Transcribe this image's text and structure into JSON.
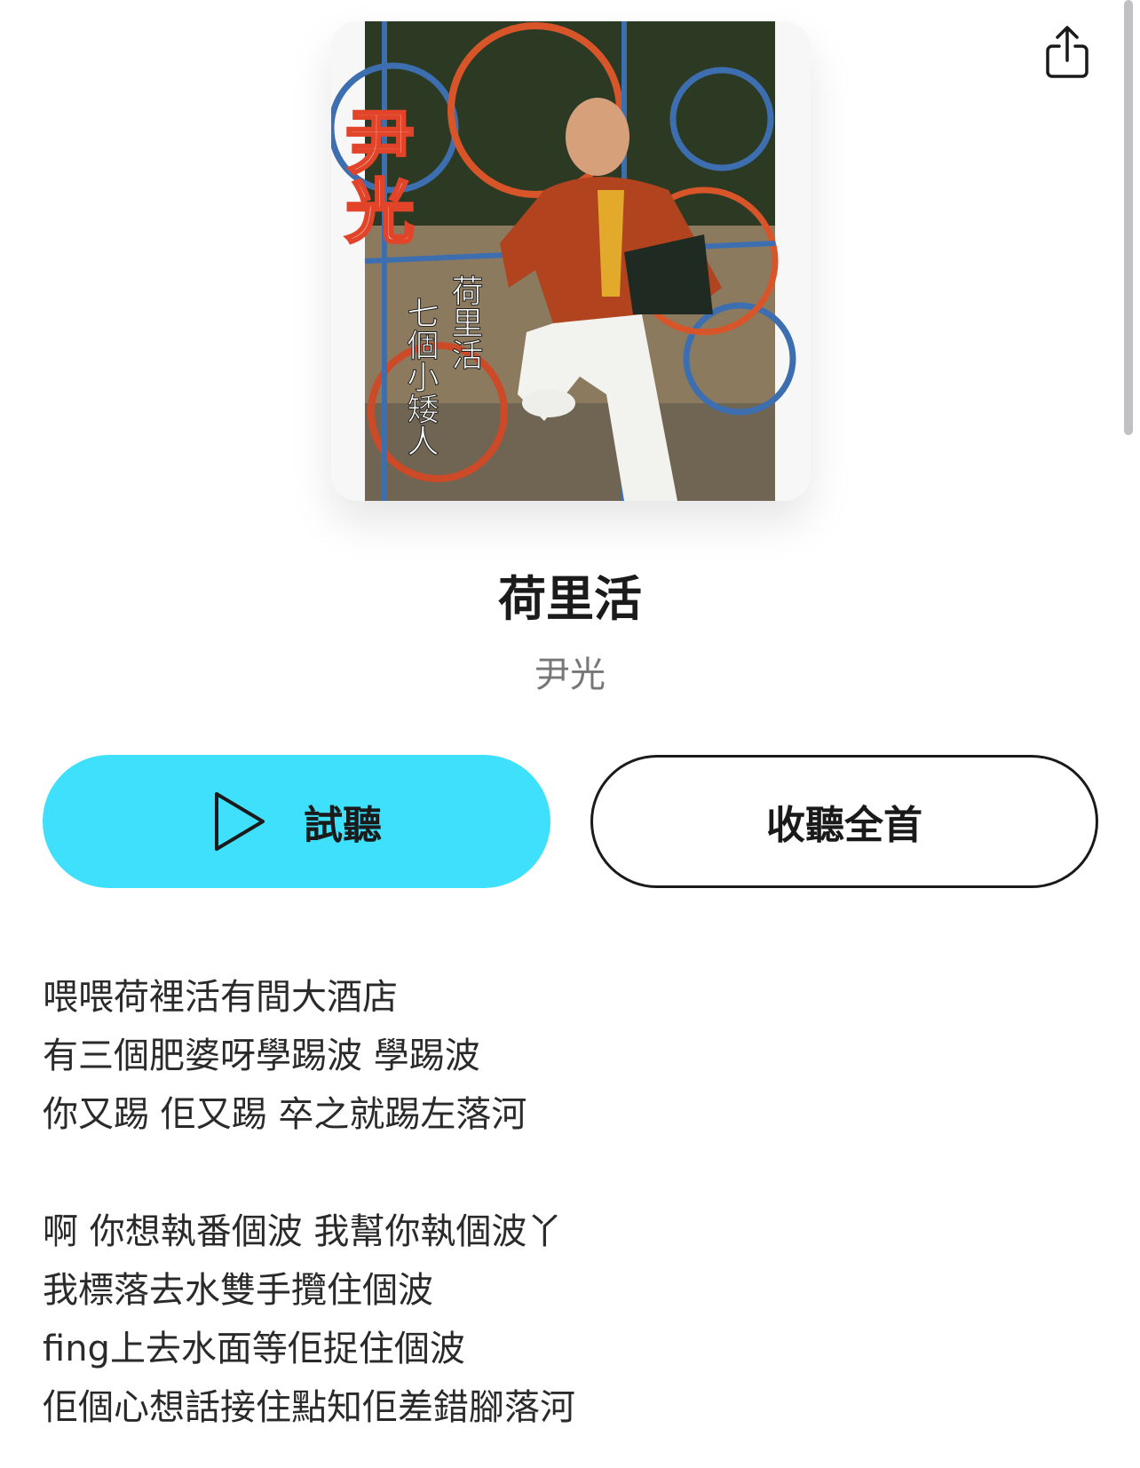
{
  "album": {
    "cover_text_artist": "尹光",
    "cover_text_title": "荷里活",
    "cover_text_subtitle": "七個小矮人"
  },
  "song": {
    "title": "荷里活",
    "artist": "尹光"
  },
  "actions": {
    "preview_label": "試聽",
    "full_label": "收聽全首"
  },
  "lyrics": {
    "stanza1": [
      "喂喂荷裡活有間大酒店",
      "有三個肥婆呀學踢波 學踢波",
      "你又踢 佢又踢 卒之就踢左落河"
    ],
    "stanza2": [
      "啊 你想執番個波 我幫你執個波丫",
      "我標落去水雙手攬住個波",
      "fing上去水面等佢捉住個波",
      "佢個心想話接住點知佢差錯腳落河"
    ]
  },
  "icons": {
    "share": "share-icon",
    "play": "play-icon"
  },
  "colors": {
    "accent": "#3ee0fb"
  }
}
